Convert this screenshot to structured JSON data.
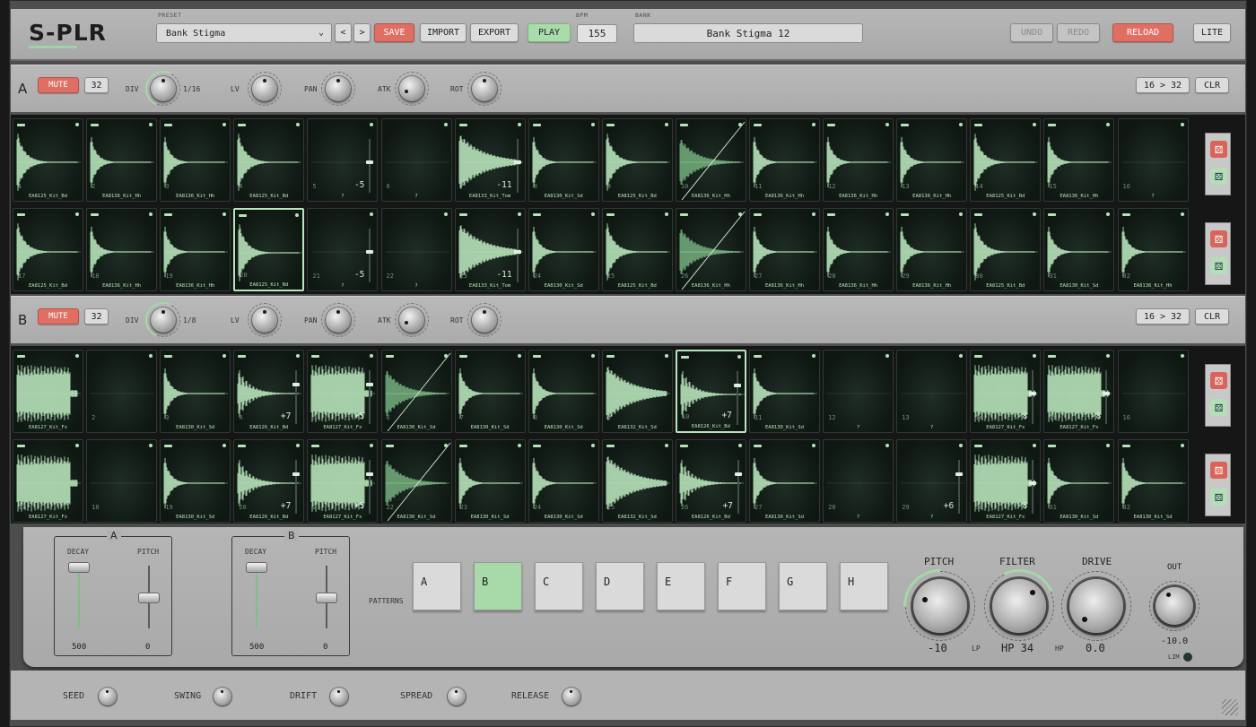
{
  "app": {
    "logo": "S-PLR"
  },
  "topbar": {
    "preset_label": "PRESET",
    "preset_value": "Bank Stigma",
    "prev": "<",
    "next": ">",
    "save": "SAVE",
    "import": "IMPORT",
    "export": "EXPORT",
    "play": "PLAY",
    "bpm_label": "BPM",
    "bpm": "155",
    "bank_label": "BANK",
    "bank_value": "Bank Stigma  12",
    "undo": "UNDO",
    "redo": "REDO",
    "reload": "RELOAD",
    "lite": "LITE"
  },
  "tracks": [
    {
      "letter": "A",
      "mute": "MUTE",
      "steps": "32",
      "div_label": "DIV",
      "div_value": "1/16",
      "lv_label": "LV",
      "pan_label": "PAN",
      "atk_label": "ATK",
      "rot_label": "ROT",
      "len": "16 > 32",
      "clr": "CLR",
      "rows": [
        [
          {
            "n": "1",
            "name": "EA8125_Kit_Bd",
            "w": "bd"
          },
          {
            "n": "2",
            "name": "EA8136_Kit_Hh",
            "w": "hh"
          },
          {
            "n": "3",
            "name": "EA8136_Kit_Hh",
            "w": "hh"
          },
          {
            "n": "4",
            "name": "EA8125_Kit_Bd",
            "w": "bd"
          },
          {
            "n": "5",
            "name": "?",
            "w": "empty",
            "pv": "-5"
          },
          {
            "n": "6",
            "name": "?",
            "w": "empty"
          },
          {
            "n": "7",
            "name": "EA8133_Kit_Tom",
            "w": "tom",
            "pv": "-11"
          },
          {
            "n": "8",
            "name": "EA8130_Kit_Sd",
            "w": "hh"
          },
          {
            "n": "9",
            "name": "EA8125_Kit_Bd",
            "w": "bd"
          },
          {
            "n": "10",
            "name": "EA8136_Kit_Hh",
            "w": "slash"
          },
          {
            "n": "11",
            "name": "EA8136_Kit_Hh",
            "w": "hh"
          },
          {
            "n": "12",
            "name": "EA8136_Kit_Hh",
            "w": "hh"
          },
          {
            "n": "13",
            "name": "EA8136_Kit_Hh",
            "w": "hh"
          },
          {
            "n": "14",
            "name": "EA8125_Kit_Bd",
            "w": "bd"
          },
          {
            "n": "15",
            "name": "EA8136_Kit_Hh",
            "w": "hh"
          },
          {
            "n": "16",
            "name": "?",
            "w": "empty"
          }
        ],
        [
          {
            "n": "17",
            "name": "EA8125_Kit_Bd",
            "w": "bd"
          },
          {
            "n": "18",
            "name": "EA8136_Kit_Hh",
            "w": "hh"
          },
          {
            "n": "19",
            "name": "EA8136_Kit_Hh",
            "w": "hh"
          },
          {
            "n": "20",
            "name": "EA8125_Kit_Bd",
            "w": "bd",
            "sel": true
          },
          {
            "n": "21",
            "name": "?",
            "w": "empty",
            "pv": "-5"
          },
          {
            "n": "22",
            "name": "?",
            "w": "empty"
          },
          {
            "n": "23",
            "name": "EA8133_Kit_Tom",
            "w": "tom",
            "pv": "-11"
          },
          {
            "n": "24",
            "name": "EA8130_Kit_Sd",
            "w": "hh"
          },
          {
            "n": "25",
            "name": "EA8125_Kit_Bd",
            "w": "bd"
          },
          {
            "n": "26",
            "name": "EA8136_Kit_Hh",
            "w": "slash"
          },
          {
            "n": "27",
            "name": "EA8136_Kit_Hh",
            "w": "hh"
          },
          {
            "n": "28",
            "name": "EA8136_Kit_Hh",
            "w": "hh"
          },
          {
            "n": "29",
            "name": "EA8136_Kit_Hh",
            "w": "hh"
          },
          {
            "n": "30",
            "name": "EA8125_Kit_Bd",
            "w": "bd"
          },
          {
            "n": "31",
            "name": "EA8130_Kit_Sd",
            "w": "hh"
          },
          {
            "n": "32",
            "name": "EA8136_Kit_Hh",
            "w": "hh"
          }
        ]
      ]
    },
    {
      "letter": "B",
      "mute": "MUTE",
      "steps": "32",
      "div_label": "DIV",
      "div_value": "1/8",
      "lv_label": "LV",
      "pan_label": "PAN",
      "atk_label": "ATK",
      "rot_label": "ROT",
      "len": "16 > 32",
      "clr": "CLR",
      "rows": [
        [
          {
            "n": "1",
            "name": "EA8127_Kit_Fx",
            "w": "fx"
          },
          {
            "n": "2",
            "name": "",
            "w": "empty"
          },
          {
            "n": "3",
            "name": "EA8130_Kit_Sd",
            "w": "hh"
          },
          {
            "n": "4",
            "name": "EA8126_Kit_Bd",
            "w": "burst",
            "pv": "+7"
          },
          {
            "n": "5",
            "name": "EA8127_Kit_Fx",
            "w": "fx",
            "pv": "+5"
          },
          {
            "n": "6",
            "name": "EA8130_Kit_Sd",
            "w": "slash"
          },
          {
            "n": "7",
            "name": "EA8130_Kit_Sd",
            "w": "hh"
          },
          {
            "n": "8",
            "name": "EA8130_Kit_Sd",
            "w": "hh"
          },
          {
            "n": "9",
            "name": "EA8132_Kit_Sd",
            "w": "tom"
          },
          {
            "n": "10",
            "name": "EA8126_Kit_Bd",
            "w": "burst",
            "pv": "+7",
            "sel": true
          },
          {
            "n": "11",
            "name": "EA8130_Kit_Sd",
            "w": "hh"
          },
          {
            "n": "12",
            "name": "?",
            "w": "empty"
          },
          {
            "n": "13",
            "name": "?",
            "w": "empty"
          },
          {
            "n": "14",
            "name": "EA8127_Kit_Fx",
            "w": "fx",
            "pv": "-8"
          },
          {
            "n": "15",
            "name": "EA8127_Kit_Fx",
            "w": "fx",
            "pv": "-8"
          },
          {
            "n": "16",
            "name": "",
            "w": "empty"
          }
        ],
        [
          {
            "n": "17",
            "name": "EA8127_Kit_Fx",
            "w": "fx"
          },
          {
            "n": "18",
            "name": "",
            "w": "empty"
          },
          {
            "n": "19",
            "name": "EA8130_Kit_Sd",
            "w": "hh"
          },
          {
            "n": "20",
            "name": "EA8126_Kit_Bd",
            "w": "burst",
            "pv": "+7"
          },
          {
            "n": "21",
            "name": "EA8127_Kit_Fx",
            "w": "fx",
            "pv": "+5"
          },
          {
            "n": "22",
            "name": "EA8130_Kit_Sd",
            "w": "slash"
          },
          {
            "n": "23",
            "name": "EA8130_Kit_Sd",
            "w": "hh"
          },
          {
            "n": "24",
            "name": "EA8130_Kit_Sd",
            "w": "hh"
          },
          {
            "n": "25",
            "name": "EA8132_Kit_Sd",
            "w": "tom"
          },
          {
            "n": "26",
            "name": "EA8126_Kit_Bd",
            "w": "burst",
            "pv": "+7"
          },
          {
            "n": "27",
            "name": "EA8130_Kit_Sd",
            "w": "hh"
          },
          {
            "n": "28",
            "name": "?",
            "w": "empty"
          },
          {
            "n": "29",
            "name": "?",
            "w": "empty",
            "pv": "+6"
          },
          {
            "n": "30",
            "name": "EA8127_Kit_Fx",
            "w": "fx",
            "pv": "-8"
          },
          {
            "n": "31",
            "name": "EA8130_Kit_Sd",
            "w": "hh"
          },
          {
            "n": "32",
            "name": "EA8130_Kit_Sd",
            "w": "hh"
          }
        ]
      ]
    }
  ],
  "faders": [
    {
      "title": "A",
      "decay_label": "DECAY",
      "pitch_label": "PITCH",
      "decay": "500",
      "pitch": "0"
    },
    {
      "title": "B",
      "decay_label": "DECAY",
      "pitch_label": "PITCH",
      "decay": "500",
      "pitch": "0"
    }
  ],
  "patterns": {
    "label": "PATTERNS",
    "items": [
      "A",
      "B",
      "C",
      "D",
      "E",
      "F",
      "G",
      "H"
    ],
    "active": "B"
  },
  "master": {
    "pitch_label": "PITCH",
    "pitch": "-10",
    "filter_label": "FILTER",
    "filter": "HP 34",
    "lp": "LP",
    "hp": "HP",
    "drive_label": "DRIVE",
    "drive": "0.0",
    "out_label": "OUT",
    "out": "-10.0",
    "lim": "LIM"
  },
  "footer": [
    {
      "label": "SEED"
    },
    {
      "label": "SWING"
    },
    {
      "label": "DRIFT"
    },
    {
      "label": "SPREAD"
    },
    {
      "label": "RELEASE"
    }
  ],
  "colors": {
    "accent_green": "#a9dcaa",
    "accent_red": "#df6e63",
    "pad_bg": "#0f1712",
    "wave": "#b6e3b9"
  }
}
